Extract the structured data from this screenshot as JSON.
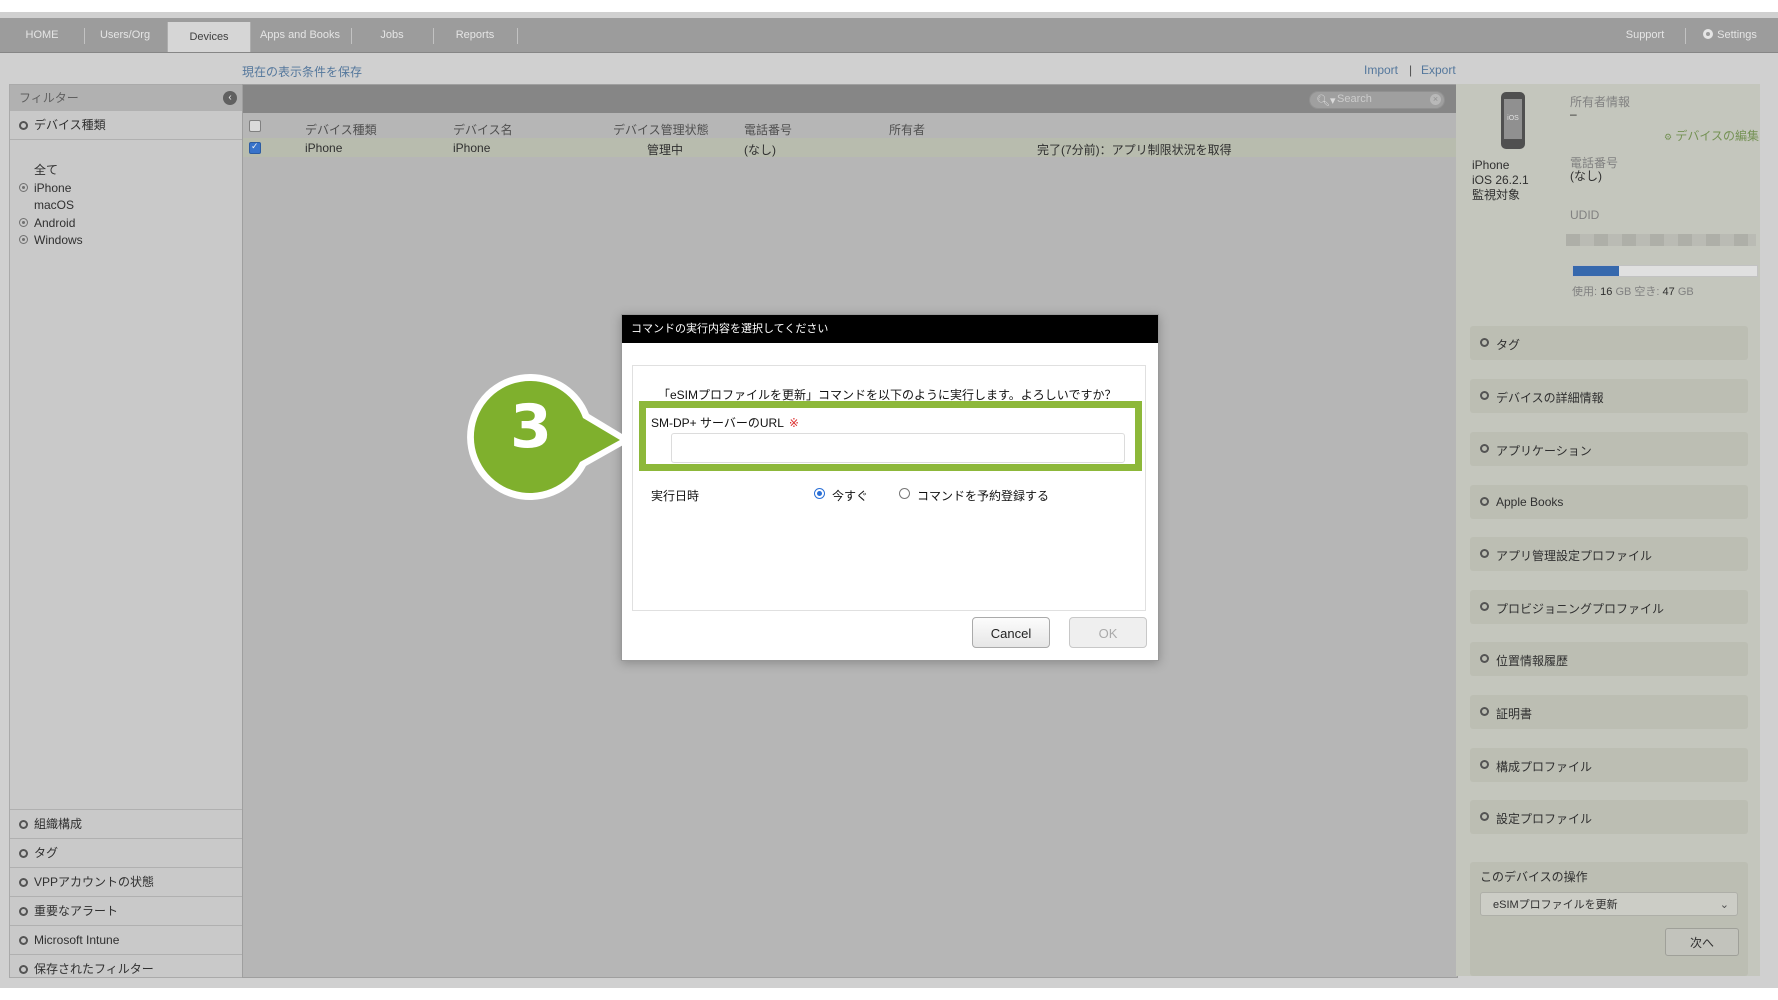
{
  "nav": {
    "tabs": [
      "HOME",
      "Users/Org",
      "Devices",
      "Apps and Books",
      "Jobs",
      "Reports"
    ],
    "active_tab": "Devices",
    "support": "Support",
    "settings": "Settings"
  },
  "toolbar": {
    "save_filter": "現在の表示条件を保存",
    "import": "Import",
    "separator": "|",
    "export": "Export"
  },
  "sidebar": {
    "header": "フィルター",
    "device_type_section": "デバイス種類",
    "device_types": [
      "全て",
      "iPhone",
      "macOS",
      "Android",
      "Windows"
    ],
    "bottom_sections": [
      "組織構成",
      "タグ",
      "VPPアカウントの状態",
      "重要なアラート",
      "Microsoft Intune",
      "保存されたフィルター"
    ]
  },
  "search": {
    "placeholder": "Search"
  },
  "table": {
    "columns": [
      "デバイス種類",
      "デバイス名",
      "デバイス管理状態",
      "電話番号",
      "所有者"
    ],
    "rows": [
      {
        "type": "iPhone",
        "name": "iPhone",
        "status": "管理中",
        "phone": "(なし)",
        "owner": "",
        "job": "完了(7分前)：アプリ制限状況を取得"
      }
    ]
  },
  "device_panel": {
    "screen_label": "iOS",
    "model": "iPhone",
    "os": "iOS 26.2.1",
    "supervised": "監視対象",
    "owner_label": "所有者情報",
    "owner_value": "–",
    "edit_link": "デバイスの編集",
    "phone_label": "電話番号",
    "phone_value": "(なし)",
    "udid_label": "UDID",
    "storage_used_label": "使用:",
    "storage_used": "16",
    "storage_free_label": "空き:",
    "storage_free": "47",
    "storage_unit": "GB",
    "storage_fill_fraction": 0.25,
    "sections": [
      "タグ",
      "デバイスの詳細情報",
      "アプリケーション",
      "Apple Books",
      "アプリ管理設定プロファイル",
      "プロビジョニングプロファイル",
      "位置情報履歴",
      "証明書",
      "構成プロファイル",
      "設定プロファイル"
    ],
    "operation_title": "このデバイスの操作",
    "operation_selected": "eSIMプロファイルを更新",
    "next_button": "次へ"
  },
  "modal": {
    "title": "コマンドの実行内容を選択してください",
    "question": "「eSIMプロファイルを更新」コマンドを以下のように実行します。よろしいですか？",
    "url_label": "SM-DP+ サーバーのURL",
    "required_mark": "※",
    "url_value": "",
    "exec_label": "実行日時",
    "option_now": "今すぐ",
    "option_schedule": "コマンドを予約登録する",
    "cancel": "Cancel",
    "ok": "OK"
  },
  "step_badge": "3",
  "colors": {
    "highlight": "#8db83a",
    "accent": "#3c7bd7"
  }
}
